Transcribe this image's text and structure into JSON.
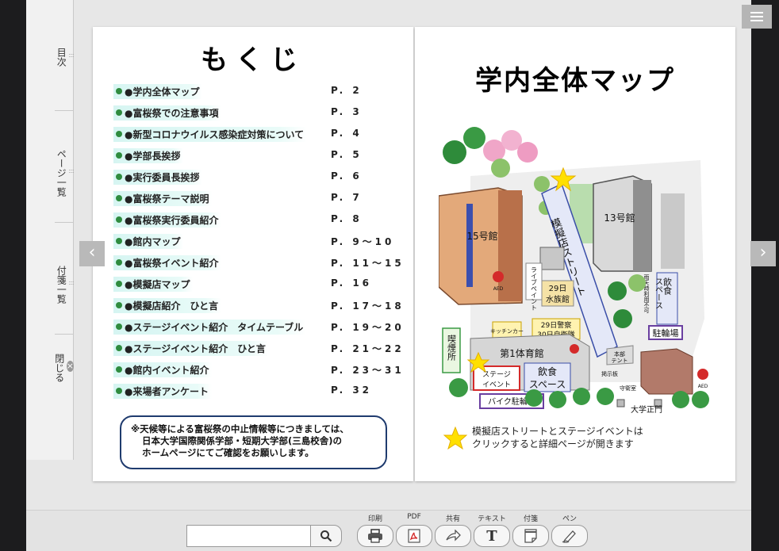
{
  "sidebar": {
    "tabs": [
      {
        "label": "目次"
      },
      {
        "label": "ページ一覧"
      },
      {
        "label": "付箋一覧"
      },
      {
        "label": "閉じる"
      }
    ]
  },
  "toc": {
    "title": "もくじ",
    "items": [
      {
        "label": "●学内全体マップ",
        "page": "P. 2"
      },
      {
        "label": "●富桜祭での注意事項",
        "page": "P. 3"
      },
      {
        "label": "●新型コロナウイルス感染症対策について",
        "page": "P. 4"
      },
      {
        "label": "●学部長挨拶",
        "page": "P. 5"
      },
      {
        "label": "●実行委員長挨拶",
        "page": "P. 6"
      },
      {
        "label": "●富桜祭テーマ説明",
        "page": "P. 7"
      },
      {
        "label": "●富桜祭実行委員紹介",
        "page": "P. 8"
      },
      {
        "label": "●館内マップ",
        "page": "P. 9～10"
      },
      {
        "label": "●富桜祭イベント紹介",
        "page": "P. 11～15"
      },
      {
        "label": "●模擬店マップ",
        "page": "P. 16"
      },
      {
        "label": "●模擬店紹介　ひと言",
        "page": "P. 17～18"
      },
      {
        "label": "●ステージイベント紹介　タイムテーブル",
        "page": "P. 19～20"
      },
      {
        "label": "●ステージイベント紹介　ひと言",
        "page": "P. 21～22"
      },
      {
        "label": "●館内イベント紹介",
        "page": "P. 23～31"
      },
      {
        "label": "●来場者アンケート",
        "page": "P. 32"
      }
    ],
    "notice": [
      "※天候等による富桜祭の中止情報等につきましては、",
      "日本大学国際関係学部・短期大学部(三島校舎)の",
      "ホームページにてご確認をお願いします。"
    ]
  },
  "map": {
    "title": "学内全体マップ",
    "labels": {
      "bldg15": "15号館",
      "bldg13": "13号館",
      "street": "模擬店ストリート",
      "live_paint": "ライブペイント",
      "aquarium_line1": "29日",
      "aquarium_line2": "水族館",
      "dining_side_1": "飲食",
      "dining_side_2": "スペース",
      "rain_note": "雨天時利用不可",
      "parking": "駐輪場",
      "smoking": "喫煙所",
      "kitchen_car": "キッチンカー",
      "police_1": "29日警察",
      "police_2": "30日自衛隊",
      "gym": "第1体育館",
      "stage_1": "ステージ",
      "stage_2": "イベント",
      "dining_1": "飲食",
      "dining_2": "スペース",
      "bike_parking": "バイク駐輪場",
      "hq_1": "本部",
      "hq_2": "テント",
      "board": "掲示板",
      "guard": "守衛室",
      "gate": "大学正門",
      "aed": "AED"
    },
    "legend": [
      "模擬店ストリートとステージイベントは",
      "クリックすると詳細ページが開きます"
    ]
  },
  "toolbar": {
    "search_placeholder": "",
    "tools": [
      {
        "label": "印刷",
        "icon": "print-icon"
      },
      {
        "label": "PDF",
        "icon": "pdf-icon"
      },
      {
        "label": "共有",
        "icon": "share-icon"
      },
      {
        "label": "テキスト",
        "icon": "text-icon"
      },
      {
        "label": "付箋",
        "icon": "sticky-note-icon"
      },
      {
        "label": "ペン",
        "icon": "pen-icon"
      }
    ]
  },
  "colors": {
    "toc_bullet": "#2f8c3f",
    "toc_highlight": "#d6f5f2",
    "notice_border": "#1f3b6e",
    "star": "#ffe000",
    "viewer_bg": "#e7e7e7"
  }
}
